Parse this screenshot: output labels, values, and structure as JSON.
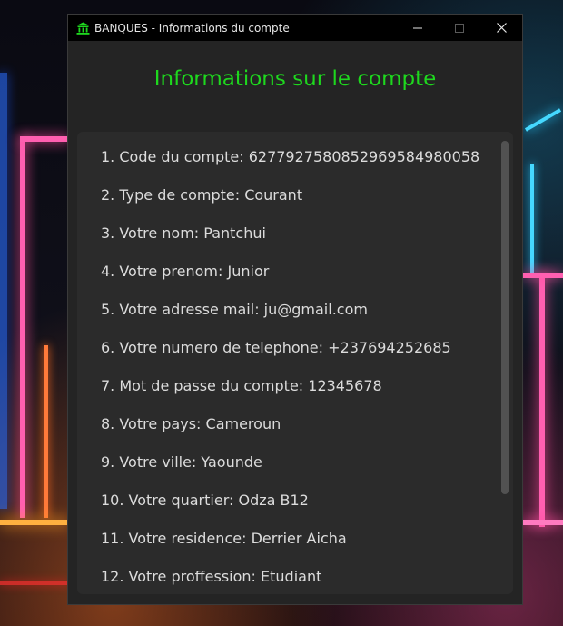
{
  "window": {
    "title": "BANQUES - Informations du compte",
    "icon": "bank-icon",
    "controls": [
      "minimize",
      "maximize",
      "close"
    ]
  },
  "heading": "Informations sur le compte",
  "items": [
    "1. Code du compte: 627792758085296958498005​8",
    "2. Type de compte: Courant",
    "3. Votre nom: Pantchui",
    "4. Votre prenom: Junior",
    "5. Votre adresse mail: ju@gmail.com",
    "6. Votre numero de telephone: +237694252685",
    "7. Mot de passe du compte: 12345678",
    "8. Votre pays: Cameroun",
    "9. Votre ville: Yaounde",
    "10. Votre quartier: Odza B12",
    "11. Votre residence: Derrier Aicha",
    "12. Votre proffession: Etudiant"
  ],
  "colors": {
    "heading": "#1ed81e",
    "window_bg": "#242424",
    "panel_bg": "#2b2b2b",
    "titlebar": "#000000"
  }
}
